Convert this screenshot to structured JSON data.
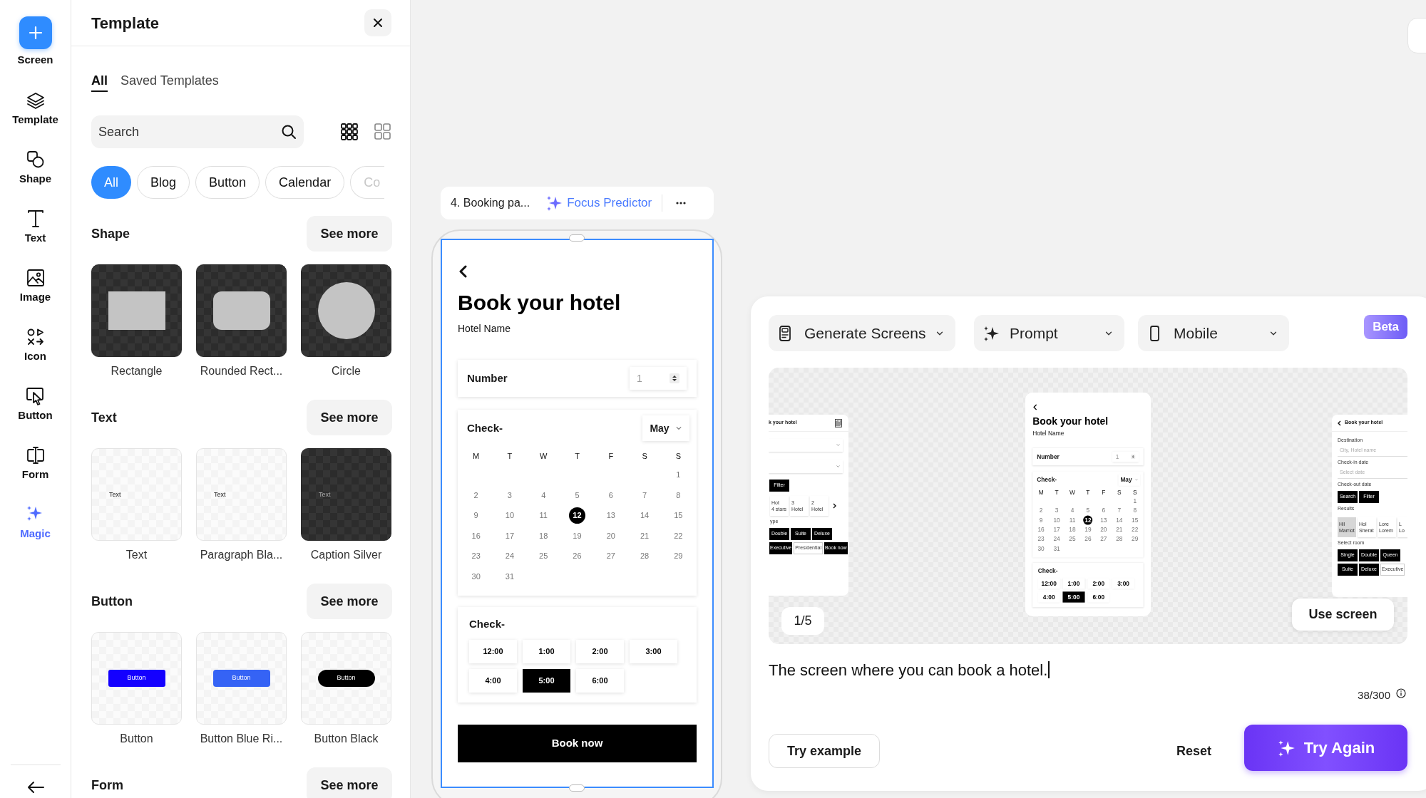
{
  "rail": {
    "items": [
      {
        "label": "Screen",
        "kind": "add",
        "selected": false
      },
      {
        "label": "Template",
        "kind": "layers",
        "selected": false
      },
      {
        "label": "Shape",
        "kind": "shape",
        "selected": false
      },
      {
        "label": "Text",
        "kind": "text",
        "selected": false
      },
      {
        "label": "Image",
        "kind": "image",
        "selected": false
      },
      {
        "label": "Icon",
        "kind": "icons",
        "selected": false
      },
      {
        "label": "Button",
        "kind": "pointer",
        "selected": false
      },
      {
        "label": "Form",
        "kind": "form",
        "selected": false
      },
      {
        "label": "Magic",
        "kind": "sparkle",
        "selected": true
      }
    ]
  },
  "template_panel": {
    "title": "Template",
    "tabs": [
      {
        "label": "All",
        "selected": true
      },
      {
        "label": "Saved Templates",
        "selected": false
      }
    ],
    "search": {
      "placeholder": "Search"
    },
    "chips": [
      {
        "label": "All",
        "selected": true
      },
      {
        "label": "Blog",
        "selected": false
      },
      {
        "label": "Button",
        "selected": false
      },
      {
        "label": "Calendar",
        "selected": false
      },
      {
        "label": "Co",
        "selected": false
      }
    ],
    "sections": [
      {
        "title": "Shape",
        "see_more": "See more",
        "items": [
          {
            "label": "Rectangle",
            "kind": "rectangle"
          },
          {
            "label": "Rounded Rect...",
            "kind": "rounded"
          },
          {
            "label": "Circle",
            "kind": "circle"
          }
        ]
      },
      {
        "title": "Text",
        "see_more": "See more",
        "items": [
          {
            "label": "Text",
            "kind": "text_light",
            "sample": "Text"
          },
          {
            "label": "Paragraph Bla...",
            "kind": "text_light",
            "sample": "Text"
          },
          {
            "label": "Caption Silver",
            "kind": "text_dark",
            "sample": "Text"
          }
        ]
      },
      {
        "title": "Button",
        "see_more": "See more",
        "items": [
          {
            "label": "Button",
            "kind": "button_blue",
            "sample": "Button"
          },
          {
            "label": "Button Blue Ri...",
            "kind": "button_royal",
            "sample": "Button"
          },
          {
            "label": "Button Black",
            "kind": "button_black",
            "sample": "Button"
          }
        ]
      },
      {
        "title": "Form",
        "see_more": "See more"
      }
    ]
  },
  "frame_bar": {
    "name": "4. Booking pa...",
    "predictor": "Focus Predictor"
  },
  "booking_screen": {
    "title": "Book your hotel",
    "subtitle": "Hotel Name",
    "number_field": {
      "label": "Number",
      "value": "1"
    },
    "date_card": {
      "label": "Check-",
      "month": "May",
      "weekdays": [
        "M",
        "T",
        "W",
        "T",
        "F",
        "S",
        "S"
      ],
      "weeks": [
        [
          {
            "kind": "blank"
          },
          {
            "kind": "blank"
          },
          {
            "kind": "blank"
          },
          {
            "kind": "blank"
          },
          {
            "kind": "blank"
          },
          {
            "kind": "blank"
          },
          {
            "kind": "day",
            "label": "1",
            "selected": false
          }
        ],
        [
          {
            "kind": "day",
            "label": "2",
            "selected": false
          },
          {
            "kind": "day",
            "label": "3",
            "selected": false
          },
          {
            "kind": "day",
            "label": "4",
            "selected": false
          },
          {
            "kind": "day",
            "label": "5",
            "selected": false
          },
          {
            "kind": "day",
            "label": "6",
            "selected": false
          },
          {
            "kind": "day",
            "label": "7",
            "selected": false
          },
          {
            "kind": "day",
            "label": "8",
            "selected": false
          }
        ],
        [
          {
            "kind": "day",
            "label": "9",
            "selected": false
          },
          {
            "kind": "day",
            "label": "10",
            "selected": false
          },
          {
            "kind": "day",
            "label": "11",
            "selected": false
          },
          {
            "kind": "day",
            "label": "12",
            "selected": true
          },
          {
            "kind": "day",
            "label": "13",
            "selected": false
          },
          {
            "kind": "day",
            "label": "14",
            "selected": false
          },
          {
            "kind": "day",
            "label": "15",
            "selected": false
          }
        ],
        [
          {
            "kind": "day",
            "label": "16",
            "selected": false
          },
          {
            "kind": "day",
            "label": "17",
            "selected": false
          },
          {
            "kind": "day",
            "label": "18",
            "selected": false
          },
          {
            "kind": "day",
            "label": "19",
            "selected": false
          },
          {
            "kind": "day",
            "label": "20",
            "selected": false
          },
          {
            "kind": "day",
            "label": "21",
            "selected": false
          },
          {
            "kind": "day",
            "label": "22",
            "selected": false
          }
        ],
        [
          {
            "kind": "day",
            "label": "23",
            "selected": false
          },
          {
            "kind": "day",
            "label": "24",
            "selected": false
          },
          {
            "kind": "day",
            "label": "25",
            "selected": false
          },
          {
            "kind": "day",
            "label": "26",
            "selected": false
          },
          {
            "kind": "day",
            "label": "27",
            "selected": false
          },
          {
            "kind": "day",
            "label": "28",
            "selected": false
          },
          {
            "kind": "day",
            "label": "29",
            "selected": false
          }
        ],
        [
          {
            "kind": "day",
            "label": "30",
            "selected": false
          },
          {
            "kind": "day",
            "label": "31",
            "selected": false
          },
          {
            "kind": "blank"
          },
          {
            "kind": "blank"
          },
          {
            "kind": "blank"
          },
          {
            "kind": "blank"
          },
          {
            "kind": "blank"
          }
        ]
      ]
    },
    "time_card": {
      "label": "Check-",
      "times": [
        {
          "label": "12:00",
          "selected": false
        },
        {
          "label": "1:00",
          "selected": false
        },
        {
          "label": "2:00",
          "selected": false
        },
        {
          "label": "3:00",
          "selected": false
        },
        {
          "label": "4:00",
          "selected": false
        },
        {
          "label": "5:00",
          "selected": true
        },
        {
          "label": "6:00",
          "selected": false
        }
      ]
    },
    "book_button": "Book now"
  },
  "generator": {
    "dropdowns": [
      {
        "label": "Generate Screens",
        "kind": "screens"
      },
      {
        "label": "Prompt",
        "kind": "sparkle"
      },
      {
        "label": "Mobile",
        "kind": "phone"
      }
    ],
    "badge": "Beta",
    "preview": {
      "counter": "1/5",
      "use_button": "Use screen",
      "left_screen": {
        "blocks": [
          {
            "kind": "header_image",
            "text": "k your hotel"
          },
          {
            "kind": "select"
          },
          {
            "kind": "select"
          },
          {
            "kind": "buttons",
            "items": [
              {
                "label": "Filter",
                "filled": true
              }
            ]
          },
          {
            "kind": "cards",
            "more": true,
            "items": [
              {
                "lines": [
                  "Hot",
                  "4 stars"
                ],
                "selected": false
              },
              {
                "lines": [
                  "3",
                  "Hotel"
                ],
                "selected": false
              },
              {
                "lines": [
                  "2",
                  "Hotel"
                ],
                "selected": false
              }
            ]
          },
          {
            "kind": "label",
            "text": "ype"
          },
          {
            "kind": "buttons",
            "items": [
              {
                "label": "Double",
                "filled": true
              },
              {
                "label": "Suite",
                "filled": true
              },
              {
                "label": "Deluxe",
                "filled": true
              }
            ]
          },
          {
            "kind": "buttons",
            "items": [
              {
                "label": "Executive",
                "filled": true
              },
              {
                "label": "Presidential",
                "filled": false
              },
              {
                "label": "Book now",
                "filled": true
              }
            ]
          }
        ]
      },
      "center_screen": {
        "title": "Book your hotel",
        "subtitle": "Hotel Name",
        "number_field": {
          "label": "Number",
          "value": "1"
        },
        "date_card": {
          "label": "Check-",
          "month": "May",
          "weekdays": [
            "M",
            "T",
            "W",
            "T",
            "F",
            "S",
            "S"
          ],
          "weeks": [
            [
              {
                "kind": "blank"
              },
              {
                "kind": "blank"
              },
              {
                "kind": "blank"
              },
              {
                "kind": "blank"
              },
              {
                "kind": "blank"
              },
              {
                "kind": "blank"
              },
              {
                "kind": "day",
                "label": "1",
                "selected": false
              }
            ],
            [
              {
                "kind": "day",
                "label": "2",
                "selected": false
              },
              {
                "kind": "day",
                "label": "3",
                "selected": false
              },
              {
                "kind": "day",
                "label": "4",
                "selected": false
              },
              {
                "kind": "day",
                "label": "5",
                "selected": false
              },
              {
                "kind": "day",
                "label": "6",
                "selected": false
              },
              {
                "kind": "day",
                "label": "7",
                "selected": false
              },
              {
                "kind": "day",
                "label": "8",
                "selected": false
              }
            ],
            [
              {
                "kind": "day",
                "label": "9",
                "selected": false
              },
              {
                "kind": "day",
                "label": "10",
                "selected": false
              },
              {
                "kind": "day",
                "label": "11",
                "selected": false
              },
              {
                "kind": "day",
                "label": "12",
                "selected": true
              },
              {
                "kind": "day",
                "label": "13",
                "selected": false
              },
              {
                "kind": "day",
                "label": "14",
                "selected": false
              },
              {
                "kind": "day",
                "label": "15",
                "selected": false
              }
            ],
            [
              {
                "kind": "day",
                "label": "16",
                "selected": false
              },
              {
                "kind": "day",
                "label": "17",
                "selected": false
              },
              {
                "kind": "day",
                "label": "18",
                "selected": false
              },
              {
                "kind": "day",
                "label": "19",
                "selected": false
              },
              {
                "kind": "day",
                "label": "20",
                "selected": false
              },
              {
                "kind": "day",
                "label": "21",
                "selected": false
              },
              {
                "kind": "day",
                "label": "22",
                "selected": false
              }
            ],
            [
              {
                "kind": "day",
                "label": "23",
                "selected": false
              },
              {
                "kind": "day",
                "label": "24",
                "selected": false
              },
              {
                "kind": "day",
                "label": "25",
                "selected": false
              },
              {
                "kind": "day",
                "label": "26",
                "selected": false
              },
              {
                "kind": "day",
                "label": "27",
                "selected": false
              },
              {
                "kind": "day",
                "label": "28",
                "selected": false
              },
              {
                "kind": "day",
                "label": "29",
                "selected": false
              }
            ],
            [
              {
                "kind": "day",
                "label": "30",
                "selected": false
              },
              {
                "kind": "day",
                "label": "31",
                "selected": false
              },
              {
                "kind": "blank"
              },
              {
                "kind": "blank"
              },
              {
                "kind": "blank"
              },
              {
                "kind": "blank"
              },
              {
                "kind": "blank"
              }
            ]
          ]
        },
        "time_card": {
          "label": "Check-",
          "times": [
            {
              "label": "12:00",
              "selected": false
            },
            {
              "label": "1:00",
              "selected": false
            },
            {
              "label": "2:00",
              "selected": false
            },
            {
              "label": "3:00",
              "selected": false
            },
            {
              "label": "4:00",
              "selected": false
            },
            {
              "label": "5:00",
              "selected": true
            },
            {
              "label": "6:00",
              "selected": false
            }
          ]
        }
      },
      "right_screen": {
        "blocks": [
          {
            "kind": "header_back",
            "text": "Book your hotel"
          },
          {
            "kind": "label",
            "text": "Destination"
          },
          {
            "kind": "field",
            "placeholder": "City, Hotel name"
          },
          {
            "kind": "label",
            "text": "Check-in date"
          },
          {
            "kind": "field",
            "placeholder": "Select date"
          },
          {
            "kind": "label",
            "text": "Check-out date"
          },
          {
            "kind": "buttons",
            "items": [
              {
                "label": "Search",
                "filled": true
              },
              {
                "label": "Filter",
                "filled": true
              }
            ]
          },
          {
            "kind": "label",
            "text": "Results"
          },
          {
            "kind": "cards",
            "items": [
              {
                "lines": [
                  "Hil",
                  "Marriot"
                ],
                "selected": true
              },
              {
                "lines": [
                  "Hol",
                  "Sherat"
                ],
                "selected": false
              },
              {
                "lines": [
                  "Lore",
                  "Lorem"
                ],
                "selected": false
              },
              {
                "lines": [
                  "L",
                  "Lo"
                ],
                "selected": false
              }
            ]
          },
          {
            "kind": "label",
            "text": "Select room"
          },
          {
            "kind": "buttons",
            "items": [
              {
                "label": "Single",
                "filled": true
              },
              {
                "label": "Double",
                "filled": true
              },
              {
                "label": "Queen",
                "filled": true
              }
            ]
          },
          {
            "kind": "buttons",
            "items": [
              {
                "label": "Suite",
                "filled": true
              },
              {
                "label": "Deluxe",
                "filled": true
              },
              {
                "label": "Executive",
                "filled": false
              }
            ]
          }
        ]
      }
    },
    "prompt": {
      "value": "The screen where you can book a hotel.",
      "count": "38/300"
    },
    "try_example": "Try example",
    "reset": "Reset",
    "try_again": "Try Again"
  }
}
